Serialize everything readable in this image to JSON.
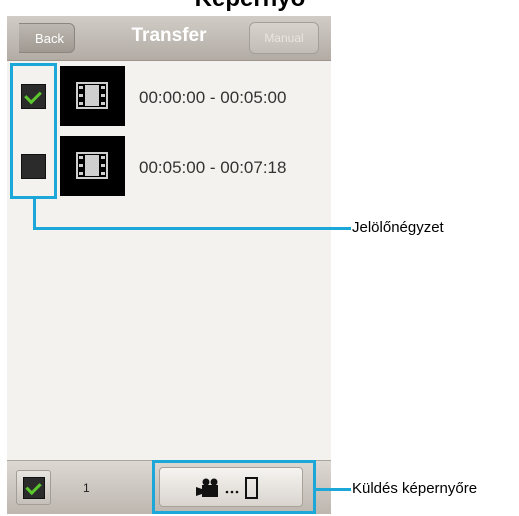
{
  "page_heading": "Képernyő",
  "nav": {
    "back_label": "Back",
    "title": "Transfer",
    "manual_label": "Manual"
  },
  "clips": [
    {
      "range": "00:00:00 - 00:05:00",
      "checked": true
    },
    {
      "range": "00:05:00 - 00:07:18",
      "checked": false
    }
  ],
  "bottom": {
    "selected_count": "1",
    "select_all_checked": true,
    "send_icon": "video-camera-to-phone-icon"
  },
  "callouts": {
    "checkbox_label": "Jelölőnégyzet",
    "send_label": "Küldés képernyőre"
  },
  "colors": {
    "highlight": "#1ba8d8",
    "check": "#5cc62e",
    "nav_bar": "#b9b3ac",
    "background": "#f4f2ef"
  }
}
